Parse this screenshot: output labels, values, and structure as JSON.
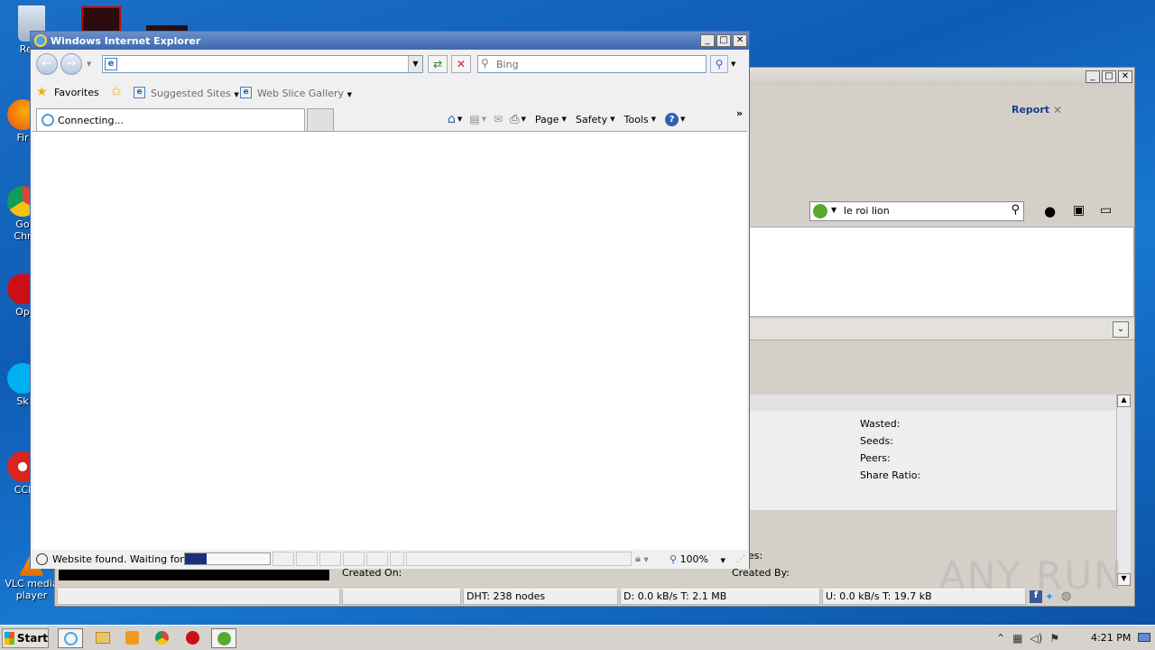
{
  "desktop": {
    "icons": [
      {
        "label": "Recy",
        "icon": "recycle-bin-icon"
      },
      {
        "label": "Fir",
        "icon": "firefox-icon"
      },
      {
        "label": "Go\nChr",
        "icon": "chrome-icon"
      },
      {
        "label": "Op",
        "icon": "opera-icon"
      },
      {
        "label": "Sk",
        "icon": "skype-icon"
      },
      {
        "label": "CCl",
        "icon": "ccleaner-icon"
      },
      {
        "label": "VLC media player",
        "icon": "vlc-icon"
      }
    ]
  },
  "utorrent": {
    "report_label": "Report",
    "search_value": "le roi lion",
    "details": {
      "wasted": "Wasted:",
      "seeds": "Seeds:",
      "peers": "Peers:",
      "share_ratio": "Share Ratio:",
      "created_on": "Created On:",
      "created_by": "Created By:",
      "es_fragment": "es:"
    },
    "status": {
      "dht": "DHT: 238 nodes",
      "download": "D: 0.0 kB/s T: 2.1 MB",
      "upload": "U: 0.0 kB/s T: 19.7 kB"
    },
    "watermark": "ANY RUN"
  },
  "ie": {
    "title": "Windows Internet Explorer",
    "address_value": "",
    "search_placeholder": "Bing",
    "favorites_label": "Favorites",
    "suggested_label": "Suggested Sites",
    "webslice_label": "Web Slice Gallery",
    "tab_label": "Connecting...",
    "menus": {
      "page": "Page",
      "safety": "Safety",
      "tools": "Tools"
    },
    "status_text": "Website found. Waiting for re",
    "zoom": "100%"
  },
  "taskbar": {
    "start_label": "Start",
    "clock": "4:21 PM"
  },
  "colors": {
    "ie_link": "#1a3e8c",
    "progress": "#1b2f7a"
  }
}
